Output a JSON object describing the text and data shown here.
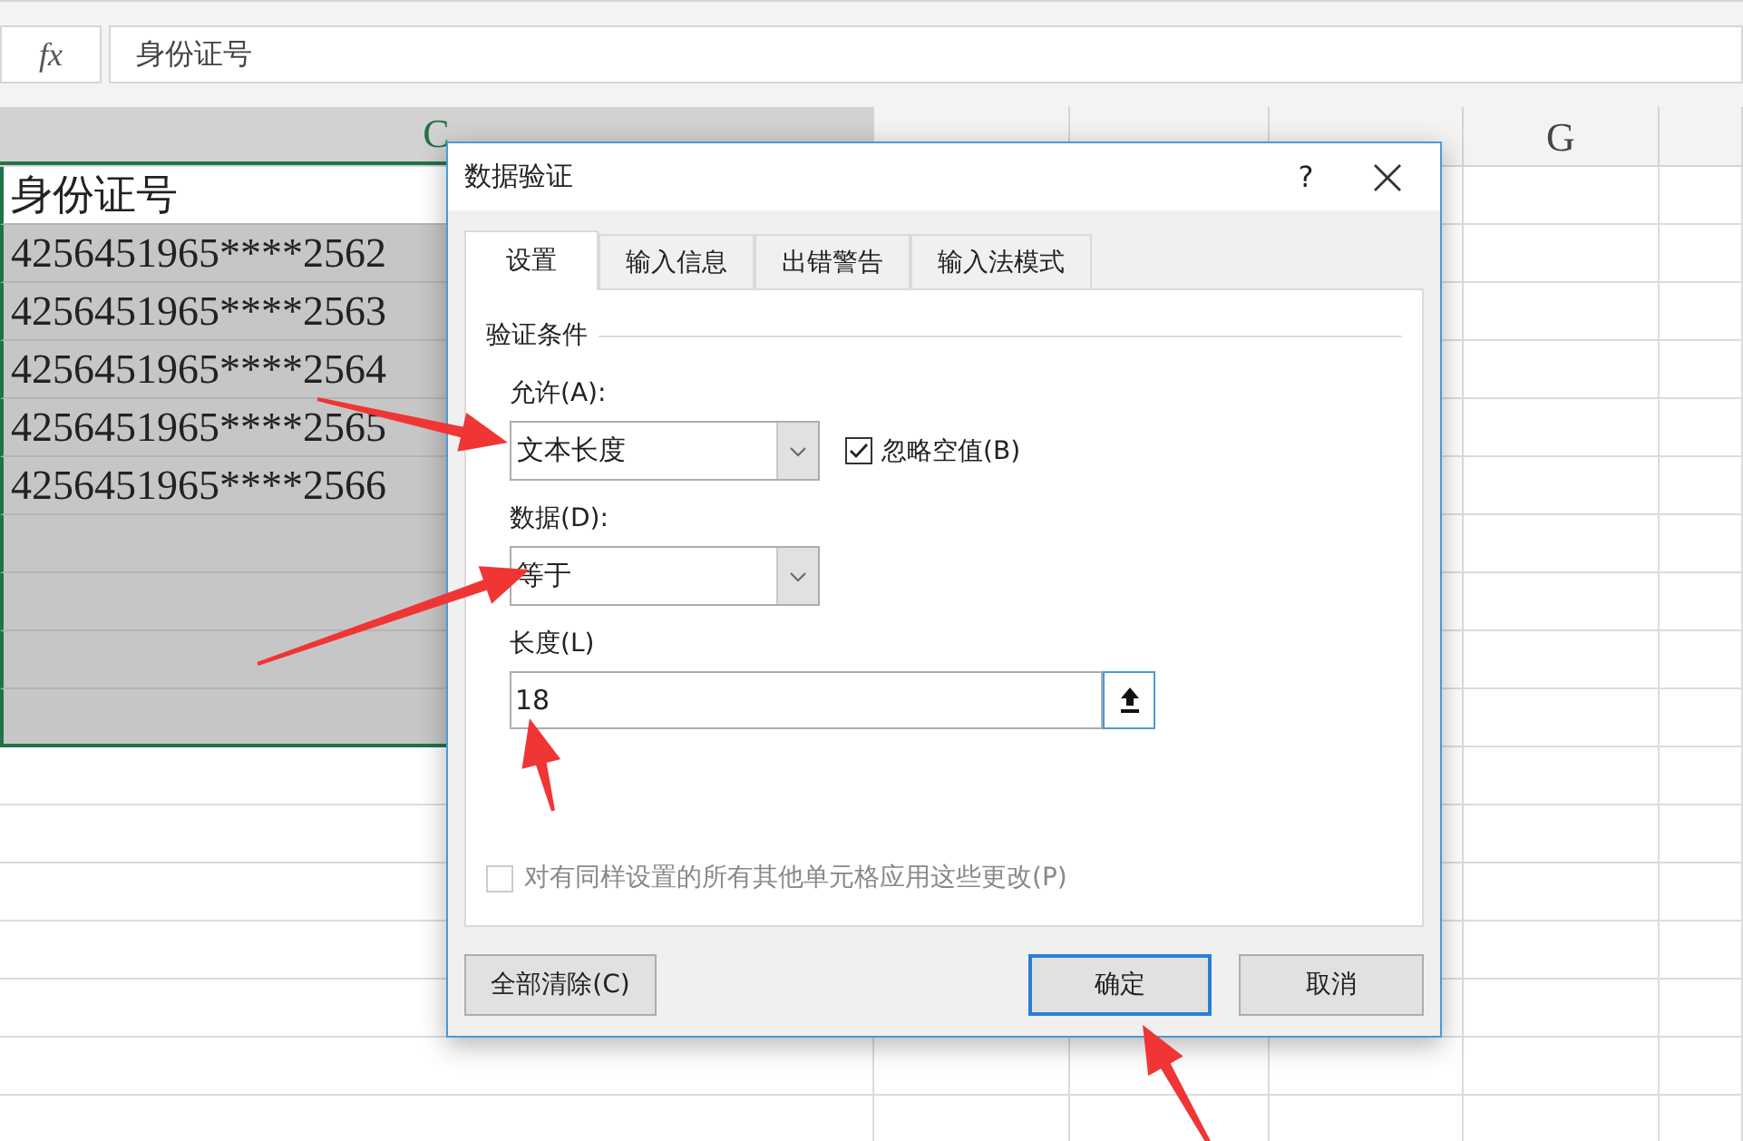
{
  "formula_bar": {
    "fx": "fx",
    "value": "身份证号"
  },
  "columns": [
    {
      "label": "C",
      "selected": true
    },
    {
      "selected": false
    },
    {
      "selected": false
    },
    {
      "selected": false
    },
    {
      "label": "G",
      "selected": false
    }
  ],
  "rows": [
    {
      "c": "身份证号",
      "selected": true,
      "active": true
    },
    {
      "c": "4256451965****2562",
      "selected": true,
      "active": false
    },
    {
      "c": "4256451965****2563",
      "selected": true,
      "active": false
    },
    {
      "c": "4256451965****2564",
      "selected": true,
      "active": false
    },
    {
      "c": "4256451965****2565",
      "selected": true,
      "active": false
    },
    {
      "c": "4256451965****2566",
      "selected": true,
      "active": false
    },
    {
      "selected": true,
      "active": false
    },
    {
      "selected": true,
      "active": false
    },
    {
      "selected": true,
      "active": false
    },
    {
      "selected": true,
      "active": false
    }
  ],
  "dialog": {
    "title": "数据验证",
    "help": "?",
    "tabs": [
      {
        "label": "设置",
        "selected": true
      },
      {
        "label": "输入信息",
        "selected": false
      },
      {
        "label": "出错警告",
        "selected": false
      },
      {
        "label": "输入法模式",
        "selected": false
      }
    ],
    "section_title": "验证条件",
    "allow": {
      "label": "允许(A):",
      "value": "文本长度"
    },
    "ignore_blank": {
      "label": "忽略空值(B)",
      "checked": true
    },
    "data": {
      "label": "数据(D):",
      "value": "等于"
    },
    "length": {
      "label": "长度(L)",
      "value": "18"
    },
    "apply_all": {
      "label": "对有同样设置的所有其他单元格应用这些更改(P)",
      "checked": false,
      "disabled": true
    },
    "buttons": [
      {
        "label": "全部清除(C)",
        "kind": "clear",
        "focused": false
      },
      {
        "label": "确定",
        "kind": "ok",
        "focused": true
      },
      {
        "label": "取消",
        "kind": "cancel",
        "focused": false
      }
    ]
  }
}
